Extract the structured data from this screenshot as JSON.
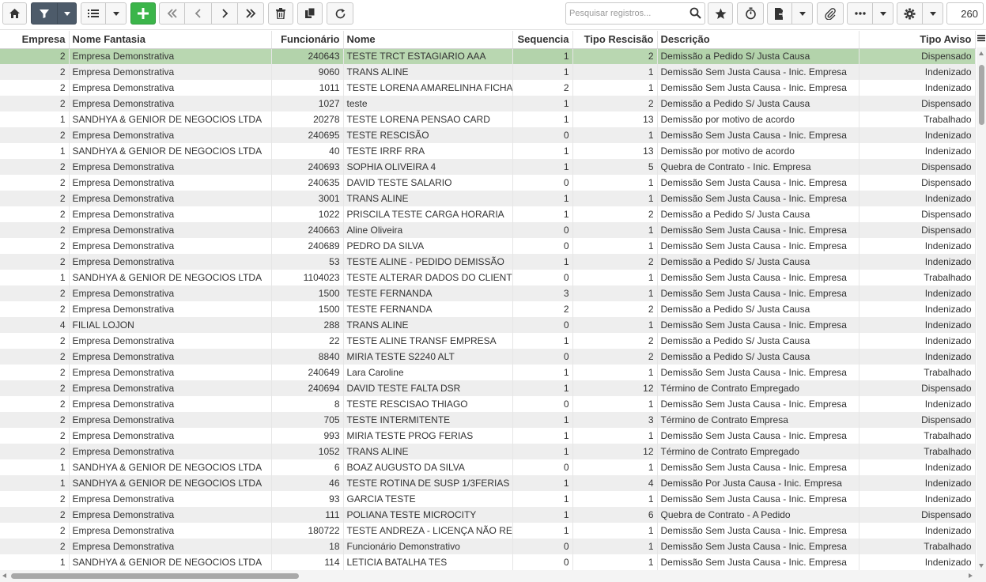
{
  "toolbar": {
    "search_placeholder": "Pesquisar registros...",
    "record_count": "260",
    "icons": [
      "home-icon",
      "filter-icon",
      "list-icon",
      "plus-icon",
      "first-icon",
      "prev-icon",
      "next-icon",
      "last-icon",
      "trash-icon",
      "copy-icon",
      "refresh-icon",
      "search-icon",
      "star-icon",
      "timer-icon",
      "export-icon",
      "paperclip-icon",
      "more-icon",
      "gear-icon"
    ],
    "accent": "#3bb54a",
    "filter_active": "#4d5b6a"
  },
  "grid": {
    "columns": [
      "Empresa",
      "Nome Fantasia",
      "Funcionário",
      "Nome",
      "Sequencia",
      "Tipo Rescisão",
      "Descrição",
      "Tipo Aviso"
    ],
    "selected_row_color": "#b9d7b1",
    "rows": [
      [
        "2",
        "Empresa Demonstrativa",
        "240643",
        "TESTE TRCT ESTAGIARIO AAA",
        "1",
        "2",
        "Demissão a Pedido S/ Justa Causa",
        "Dispensado"
      ],
      [
        "2",
        "Empresa Demonstrativa",
        "9060",
        "TRANS ALINE",
        "1",
        "1",
        "Demissão Sem Justa Causa - Inic. Empresa",
        "Indenizado"
      ],
      [
        "2",
        "Empresa Demonstrativa",
        "1011",
        "TESTE LORENA AMARELINHA FICHA",
        "2",
        "1",
        "Demissão Sem Justa Causa - Inic. Empresa",
        "Indenizado"
      ],
      [
        "2",
        "Empresa Demonstrativa",
        "1027",
        "teste",
        "1",
        "2",
        "Demissão a Pedido S/ Justa Causa",
        "Dispensado"
      ],
      [
        "1",
        "SANDHYA & GENIOR DE NEGOCIOS LTDA",
        "20278",
        "TESTE LORENA PENSAO CARD",
        "1",
        "13",
        "Demissão por motivo de acordo",
        "Trabalhado"
      ],
      [
        "2",
        "Empresa Demonstrativa",
        "240695",
        "TESTE RESCISÃO",
        "0",
        "1",
        "Demissão Sem Justa Causa - Inic. Empresa",
        "Indenizado"
      ],
      [
        "1",
        "SANDHYA & GENIOR DE NEGOCIOS LTDA",
        "40",
        "TESTE IRRF RRA",
        "1",
        "13",
        "Demissão por motivo de acordo",
        "Indenizado"
      ],
      [
        "2",
        "Empresa Demonstrativa",
        "240693",
        "SOPHIA OLIVEIRA 4",
        "1",
        "5",
        "Quebra de Contrato - Inic. Empresa",
        "Dispensado"
      ],
      [
        "2",
        "Empresa Demonstrativa",
        "240635",
        "DAVID TESTE SALARIO",
        "0",
        "1",
        "Demissão Sem Justa Causa - Inic. Empresa",
        "Dispensado"
      ],
      [
        "2",
        "Empresa Demonstrativa",
        "3001",
        "TRANS ALINE",
        "1",
        "1",
        "Demissão Sem Justa Causa - Inic. Empresa",
        "Indenizado"
      ],
      [
        "2",
        "Empresa Demonstrativa",
        "1022",
        "PRISCILA TESTE CARGA HORARIA",
        "1",
        "2",
        "Demissão a Pedido S/ Justa Causa",
        "Dispensado"
      ],
      [
        "2",
        "Empresa Demonstrativa",
        "240663",
        "Aline Oliveira",
        "0",
        "1",
        "Demissão Sem Justa Causa - Inic. Empresa",
        "Dispensado"
      ],
      [
        "2",
        "Empresa Demonstrativa",
        "240689",
        "PEDRO DA SILVA",
        "0",
        "1",
        "Demissão Sem Justa Causa - Inic. Empresa",
        "Indenizado"
      ],
      [
        "2",
        "Empresa Demonstrativa",
        "53",
        "TESTE ALINE - PEDIDO DEMISSÃO",
        "1",
        "2",
        "Demissão a Pedido S/ Justa Causa",
        "Indenizado"
      ],
      [
        "1",
        "SANDHYA & GENIOR DE NEGOCIOS LTDA",
        "1104023",
        "TESTE ALTERAR DADOS DO CLIENTE",
        "0",
        "1",
        "Demissão Sem Justa Causa - Inic. Empresa",
        "Trabalhado"
      ],
      [
        "2",
        "Empresa Demonstrativa",
        "1500",
        "TESTE FERNANDA",
        "3",
        "1",
        "Demissão Sem Justa Causa - Inic. Empresa",
        "Indenizado"
      ],
      [
        "2",
        "Empresa Demonstrativa",
        "1500",
        "TESTE FERNANDA",
        "2",
        "2",
        "Demissão a Pedido S/ Justa Causa",
        "Indenizado"
      ],
      [
        "4",
        "FILIAL LOJON",
        "288",
        "TRANS ALINE",
        "0",
        "1",
        "Demissão Sem Justa Causa - Inic. Empresa",
        "Indenizado"
      ],
      [
        "2",
        "Empresa Demonstrativa",
        "22",
        "TESTE ALINE TRANSF EMPRESA",
        "1",
        "2",
        "Demissão a Pedido S/ Justa Causa",
        "Indenizado"
      ],
      [
        "2",
        "Empresa Demonstrativa",
        "8840",
        "MIRIA TESTE S2240 ALT",
        "0",
        "2",
        "Demissão a Pedido S/ Justa Causa",
        "Indenizado"
      ],
      [
        "2",
        "Empresa Demonstrativa",
        "240649",
        "Lara Caroline",
        "1",
        "1",
        "Demissão Sem Justa Causa - Inic. Empresa",
        "Trabalhado"
      ],
      [
        "2",
        "Empresa Demonstrativa",
        "240694",
        "DAVID TESTE FALTA DSR",
        "1",
        "12",
        "Término de Contrato Empregado",
        "Dispensado"
      ],
      [
        "2",
        "Empresa Demonstrativa",
        "8",
        "TESTE RESCISAO THIAGO",
        "0",
        "1",
        "Demissão Sem Justa Causa - Inic. Empresa",
        "Indenizado"
      ],
      [
        "2",
        "Empresa Demonstrativa",
        "705",
        "TESTE INTERMITENTE",
        "1",
        "3",
        "Término de Contrato Empresa",
        "Dispensado"
      ],
      [
        "2",
        "Empresa Demonstrativa",
        "993",
        "MIRIA TESTE PROG FERIAS",
        "1",
        "1",
        "Demissão Sem Justa Causa - Inic. Empresa",
        "Trabalhado"
      ],
      [
        "2",
        "Empresa Demonstrativa",
        "1052",
        "TRANS ALINE",
        "1",
        "12",
        "Término de Contrato Empregado",
        "Trabalhado"
      ],
      [
        "1",
        "SANDHYA & GENIOR DE NEGOCIOS LTDA",
        "6",
        "BOAZ AUGUSTO DA SILVA",
        "0",
        "1",
        "Demissão Sem Justa Causa - Inic. Empresa",
        "Indenizado"
      ],
      [
        "1",
        "SANDHYA & GENIOR DE NEGOCIOS LTDA",
        "46",
        "TESTE ROTINA DE SUSP 1/3FERIAS",
        "1",
        "4",
        "Demissão Por Justa Causa - Inic. Empresa",
        "Indenizado"
      ],
      [
        "2",
        "Empresa Demonstrativa",
        "93",
        "GARCIA TESTE",
        "1",
        "1",
        "Demissão Sem Justa Causa - Inic. Empresa",
        "Indenizado"
      ],
      [
        "2",
        "Empresa Demonstrativa",
        "111",
        "POLIANA TESTE MICROCITY",
        "1",
        "6",
        "Quebra de Contrato - A Pedido",
        "Dispensado"
      ],
      [
        "2",
        "Empresa Demonstrativa",
        "180722",
        "TESTE ANDREZA - LICENÇA NÃO REMUNERADA",
        "1",
        "1",
        "Demissão Sem Justa Causa - Inic. Empresa",
        "Indenizado"
      ],
      [
        "2",
        "Empresa Demonstrativa",
        "18",
        "Funcionário Demonstrativo",
        "0",
        "1",
        "Demissão Sem Justa Causa - Inic. Empresa",
        "Trabalhado"
      ],
      [
        "1",
        "SANDHYA & GENIOR DE NEGOCIOS LTDA",
        "114",
        "LETICIA BATALHA TES",
        "0",
        "1",
        "Demissão Sem Justa Causa - Inic. Empresa",
        "Indenizado"
      ]
    ]
  }
}
